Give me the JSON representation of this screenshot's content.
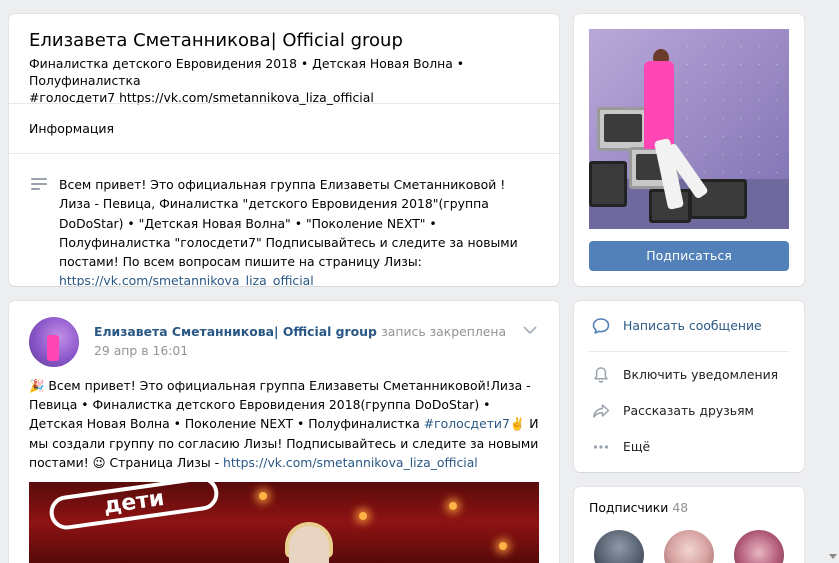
{
  "group": {
    "name": "Елизавета Сметанникова| Official group",
    "status_line1": "Финалистка детского Евровидения 2018 • Детская Новая Волна • Полуфиналистка",
    "status_line2": "#голосдети7 https://vk.com/smetannikova_liza_official"
  },
  "info": {
    "title": "Информация",
    "description_text": "Всем привет! Это официальная группа Елизаветы Сметанниковой ! Лиза - Певица, Финалистка \"детского Евровидения 2018\"(группа DoDoStar) • \"Детская Новая Волна\" • \"Поколение NEXT\" • Полуфиналистка \"голосдети7\" Подписывайтесь и следите за новыми постами! По всем вопросам пишите на страницу Лизы: ",
    "description_link": "https://vk.com/smetannikova_liza_official",
    "icon": "text-lines-icon"
  },
  "avatar_block": {
    "subscribe_label": "Подписаться"
  },
  "post": {
    "author": "Елизавета Сметанникова| Official group",
    "pinned_label": "запись закреплена",
    "date": "29 апр в 16:01",
    "emoji_party": "🎉",
    "text_part1": " Всем привет! Это официальная группа Елизаветы Сметанниковой!Лиза - Певица • Финалистка детского Евровидения 2018(группа DoDoStar) • Детская Новая Волна • Поколение NEXT • Полуфиналистка ",
    "hashtag": "#голосдети7",
    "emoji_victory": "✌️",
    "text_part2": " И мы создали группу по согласию Лизы! Подписывайтесь и следите за новыми постами! ",
    "emoji_wink": "😉",
    "text_part3": " Страница Лизы - ",
    "link": "https://vk.com/smetannikova_liza_official",
    "photo_logo_text": "дети"
  },
  "actions": {
    "message": "Написать сообщение",
    "notifications": "Включить уведомления",
    "share": "Рассказать друзьям",
    "more": "Ещё"
  },
  "followers": {
    "title": "Подписчики",
    "count": "48"
  },
  "colors": {
    "accent": "#5181b8",
    "link": "#2a5885",
    "background": "#edeef0"
  }
}
